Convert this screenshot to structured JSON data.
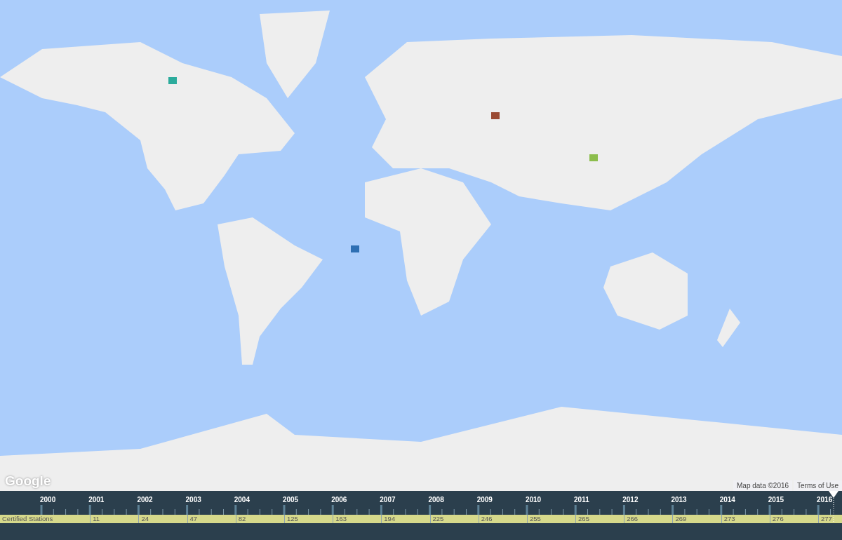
{
  "map": {
    "logo": "Google",
    "attribution": "Map data ©2016",
    "terms_link": "Terms of Use"
  },
  "timeline": {
    "years": [
      "2000",
      "2001",
      "2002",
      "2003",
      "2004",
      "2005",
      "2006",
      "2007",
      "2008",
      "2009",
      "2010",
      "2011",
      "2012",
      "2013",
      "2014",
      "2015",
      "2016"
    ],
    "series_label": "Certified Stations",
    "counts": [
      "11",
      "24",
      "47",
      "82",
      "125",
      "163",
      "194",
      "225",
      "246",
      "255",
      "265",
      "266",
      "269",
      "273",
      "276",
      "277"
    ]
  }
}
